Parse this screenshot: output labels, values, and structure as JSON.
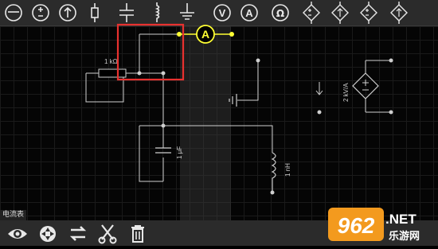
{
  "toolbar_top": {
    "buttons": [
      {
        "name": "ground-tool",
        "icon": "ground-icon"
      },
      {
        "name": "ac-source-tool",
        "icon": "ac-source-icon"
      },
      {
        "name": "dc-source-tool",
        "icon": "dc-source-icon"
      },
      {
        "name": "resistor-tool",
        "icon": "resistor-icon"
      },
      {
        "name": "capacitor-tool",
        "icon": "capacitor-icon"
      },
      {
        "name": "inductor-tool",
        "icon": "inductor-icon"
      },
      {
        "name": "ground2-tool",
        "icon": "ground-icon"
      },
      {
        "name": "voltmeter-tool",
        "icon": "voltmeter-icon"
      },
      {
        "name": "ammeter-tool",
        "icon": "ammeter-icon"
      },
      {
        "name": "ohmmeter-tool",
        "icon": "ohmmeter-icon"
      },
      {
        "name": "dependent-source-1",
        "icon": "dependent-source-icon"
      },
      {
        "name": "dependent-source-2",
        "icon": "dependent-source-icon"
      },
      {
        "name": "dependent-source-3",
        "icon": "dependent-source-icon"
      },
      {
        "name": "dependent-source-4",
        "icon": "dependent-source-icon"
      }
    ],
    "meter_glyphs": {
      "voltmeter": "V",
      "ammeter": "A",
      "ohmmeter": "Ω"
    }
  },
  "canvas": {
    "ammeter_symbol": "A",
    "resistor_label": "1 kΩ",
    "capacitor_label": "1 μF",
    "inductor_label": "1 nH",
    "source_label": "2 kV/A"
  },
  "status": {
    "tool_label": "电流表"
  },
  "toolbar_bottom": {
    "buttons": [
      {
        "name": "view-button",
        "icon": "eye-icon"
      },
      {
        "name": "rotate-button",
        "icon": "rotate-icon"
      },
      {
        "name": "flip-button",
        "icon": "flip-icon"
      },
      {
        "name": "cut-button",
        "icon": "scissors-icon"
      },
      {
        "name": "delete-button",
        "icon": "trash-icon"
      }
    ]
  },
  "watermark": {
    "logo_text": "962.NET",
    "tagline": "乐游网"
  },
  "colors": {
    "accent": "#ffff33",
    "highlight": "#e8312f",
    "wire": "#cfcfcf",
    "toolbar": "#2b2b2b"
  }
}
